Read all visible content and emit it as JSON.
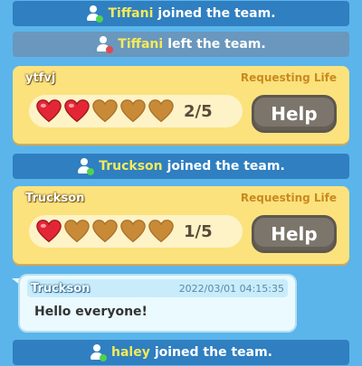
{
  "feed": {
    "events": [
      {
        "name": "Tiffani",
        "text": "joined the team."
      },
      {
        "name": "Tiffani",
        "text": "left the team."
      },
      {
        "name": "Truckson",
        "text": "joined the team."
      },
      {
        "name": "haley",
        "text": "joined the team."
      }
    ],
    "requests": [
      {
        "user": "ytfvj",
        "status": "Requesting Life",
        "filled": 2,
        "total": 5,
        "count_label": "2/5",
        "help_label": "Help"
      },
      {
        "user": "Truckson",
        "status": "Requesting Life",
        "filled": 1,
        "total": 5,
        "count_label": "1/5",
        "help_label": "Help"
      }
    ],
    "chat": {
      "user": "Truckson",
      "time": "2022/03/01 04:15:35",
      "message": "Hello everyone!"
    }
  },
  "colors": {
    "heart_full": "#e32636",
    "heart_empty": "#c88a36",
    "join_banner": "#2f7fc1",
    "left_banner": "#6a97bd"
  }
}
